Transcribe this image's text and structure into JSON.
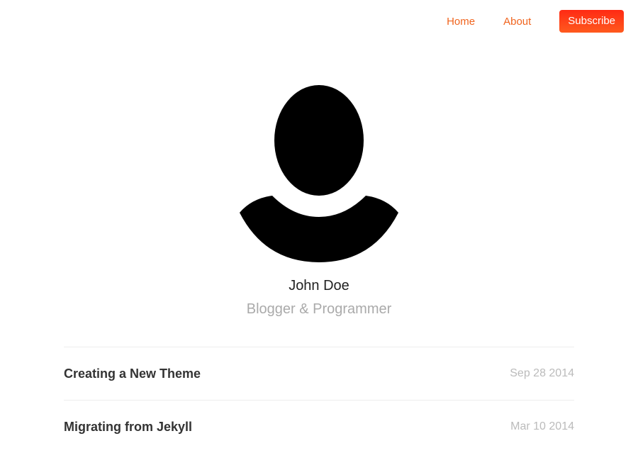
{
  "nav": {
    "home_label": "Home",
    "about_label": "About",
    "subscribe_label": "Subscribe"
  },
  "profile": {
    "avatar_icon": "person-silhouette-icon",
    "name": "John Doe",
    "tagline": "Blogger & Programmer"
  },
  "posts": [
    {
      "title": "Creating a New Theme",
      "date": "Sep 28 2014"
    },
    {
      "title": "Migrating from Jekyll",
      "date": "Mar 10 2014"
    }
  ],
  "colors": {
    "accent": "#f0641e",
    "subscribe_bg": "#ff3a18",
    "tagline": "#aaaaaa",
    "date": "#bbbbbb"
  }
}
